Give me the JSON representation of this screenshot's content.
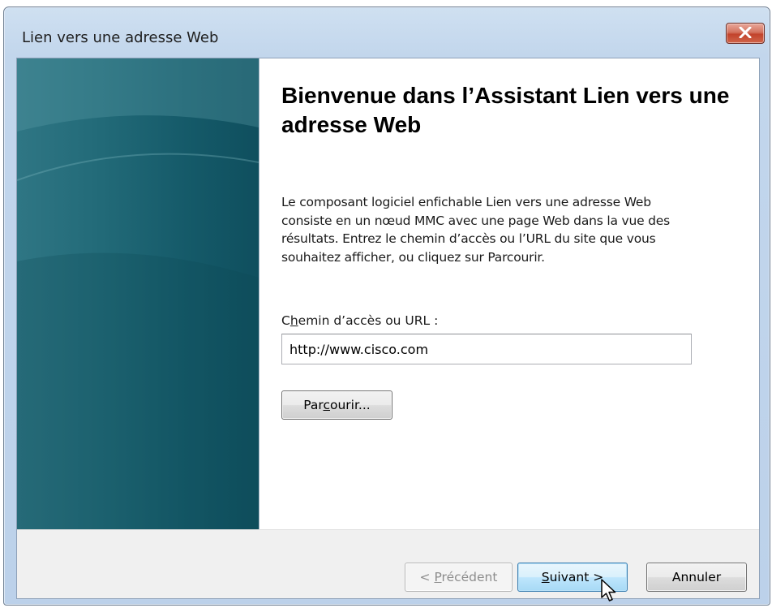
{
  "window": {
    "title": "Lien vers une adresse Web"
  },
  "wizard": {
    "heading": "Bienvenue dans l’Assistant Lien vers une adresse Web",
    "description": "Le composant logiciel enfichable Lien vers une adresse Web consiste en un nœud MMC avec une page Web dans la vue des résultats. Entrez le chemin d’accès ou l’URL du site que vous souhaitez afficher, ou cliquez sur Parcourir.",
    "url_label_pre": "C",
    "url_label_key": "h",
    "url_label_post": "emin d’accès ou URL :",
    "url_value": "http://www.cisco.com",
    "browse_pre": "Par",
    "browse_key": "c",
    "browse_post": "ourir..."
  },
  "footer": {
    "prev_pre": "< ",
    "prev_key": "P",
    "prev_post": "récédent",
    "next_key": "S",
    "next_post": "uivant >",
    "cancel_label": "Annuler"
  },
  "colors": {
    "side_panel": "#1d6473",
    "next_button_border": "#3c7fb1",
    "close_button": "#c2432c"
  },
  "icons": {
    "close": "close-icon",
    "cursor": "mouse-pointer-icon"
  }
}
